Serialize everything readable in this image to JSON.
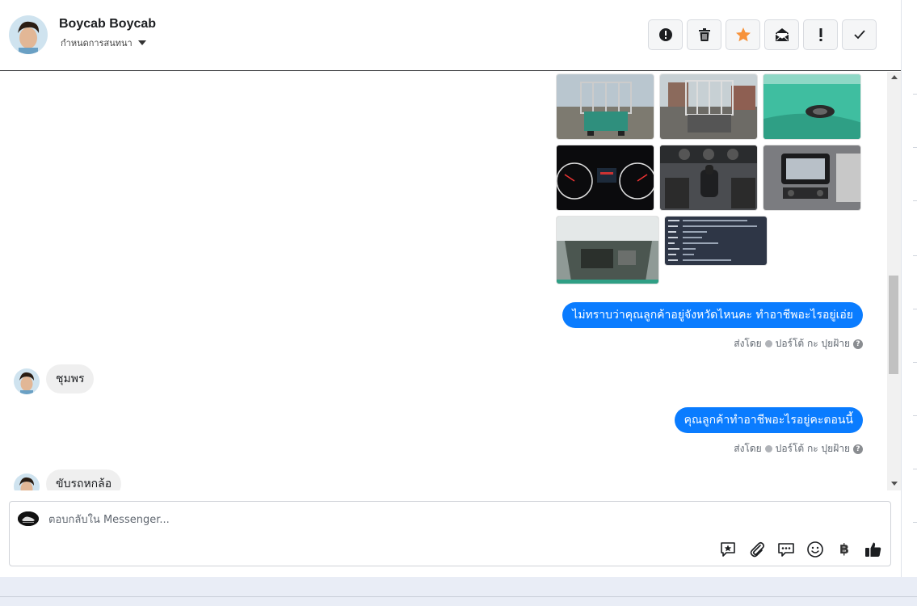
{
  "header": {
    "contact_name": "Boycab Boycab",
    "assign_label": "กำหนดการสนทนา",
    "toolbar": {
      "spam_icon": "alert-circle-icon",
      "delete_icon": "trash-icon",
      "star_icon": "star-icon",
      "mark_unread_icon": "envelope-open-icon",
      "follow_up_icon": "exclamation-icon",
      "done_icon": "check-icon",
      "star_color": "#f7923a"
    }
  },
  "messages": [
    {
      "direction": "out",
      "type": "photos",
      "count": 8
    },
    {
      "direction": "out",
      "type": "text",
      "text": "ไม่ทราบว่าคุณลูกค้าอยู่จังหวัดไหนคะ ทำอาชีพอะไรอยู่เอ่ย"
    },
    {
      "type": "sent_by",
      "prefix": "ส่งโดย",
      "agent": "ปอร์โต้ กะ ปุยฝ้าย"
    },
    {
      "direction": "in",
      "type": "text",
      "text": "ชุมพร"
    },
    {
      "direction": "out",
      "type": "text",
      "text": "คุณลูกค้าทำอาชีพอะไรอยู่คะตอนนี้"
    },
    {
      "type": "sent_by",
      "prefix": "ส่งโดย",
      "agent": "ปอร์โต้ กะ ปุยฝ้าย"
    },
    {
      "direction": "in",
      "type": "text",
      "text": "ขับรถหกล้อ"
    }
  ],
  "composer": {
    "placeholder": "ตอบกลับใน Messenger...",
    "icons": [
      "saved-reply-icon",
      "attachment-icon",
      "chat-bubbles-icon",
      "emoji-icon",
      "baht-icon",
      "thumbs-up-icon"
    ],
    "baht_symbol": "฿"
  },
  "colors": {
    "accent": "#0a7cff"
  }
}
